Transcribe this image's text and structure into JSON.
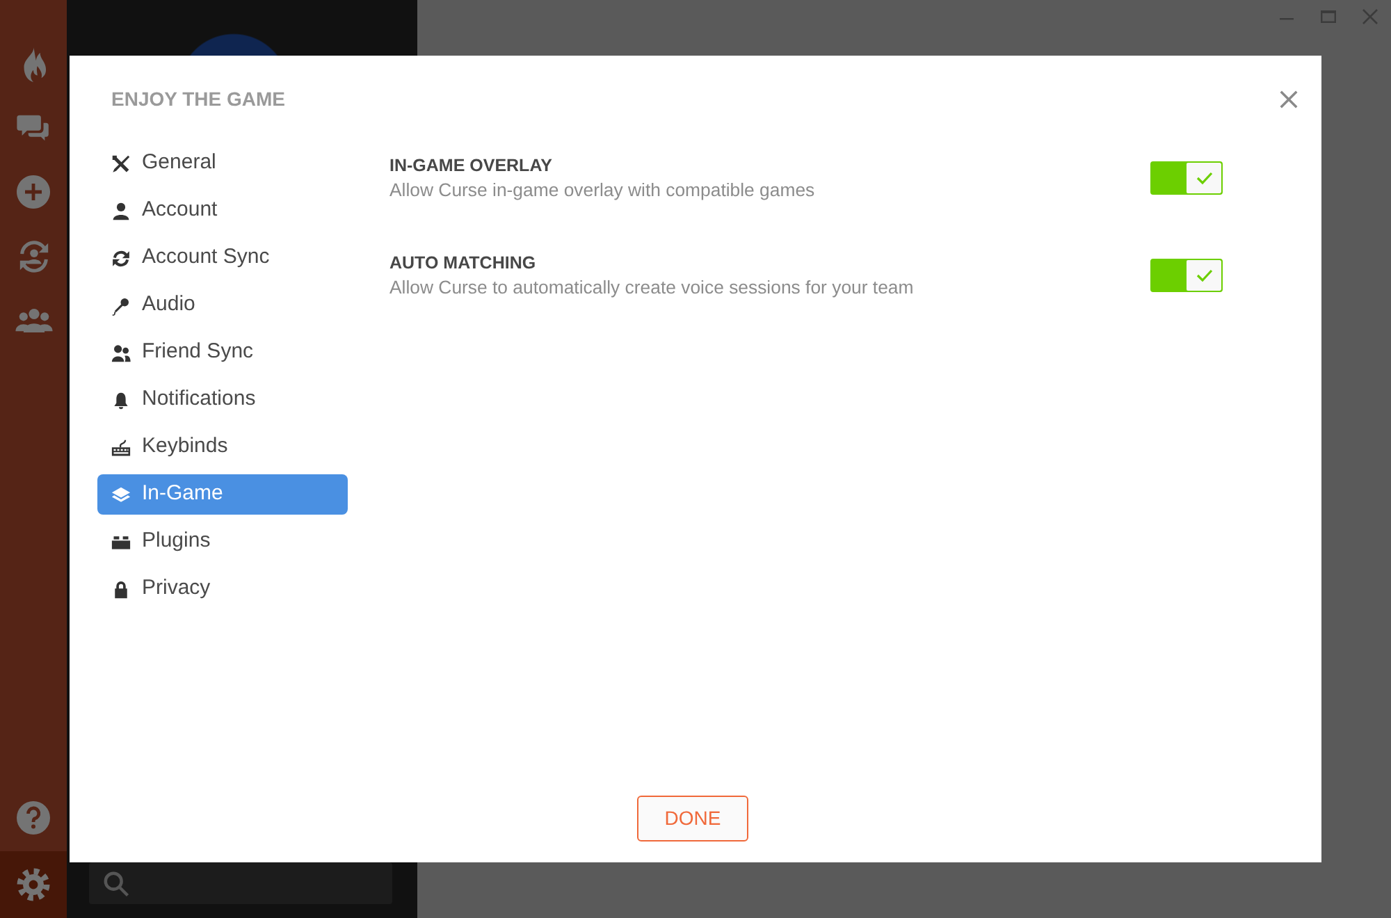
{
  "rail_top": [
    {
      "kind": "home",
      "selected": false
    },
    {
      "kind": "chat",
      "selected": false
    },
    {
      "kind": "add",
      "selected": false
    },
    {
      "kind": "sync",
      "selected": false
    },
    {
      "kind": "groups",
      "selected": false
    }
  ],
  "rail_bottom": [
    {
      "kind": "help",
      "selected": false
    },
    {
      "kind": "settings",
      "selected": true
    }
  ],
  "dialog": {
    "title": "ENJOY THE GAME",
    "nav": [
      {
        "kind": "general",
        "label": "General",
        "selected": false
      },
      {
        "kind": "account",
        "label": "Account",
        "selected": false
      },
      {
        "kind": "account_sync",
        "label": "Account Sync",
        "selected": false
      },
      {
        "kind": "audio",
        "label": "Audio",
        "selected": false
      },
      {
        "kind": "friend_sync",
        "label": "Friend Sync",
        "selected": false
      },
      {
        "kind": "notifications",
        "label": "Notifications",
        "selected": false
      },
      {
        "kind": "keybinds",
        "label": "Keybinds",
        "selected": false
      },
      {
        "kind": "in_game",
        "label": "In-Game",
        "selected": true
      },
      {
        "kind": "plugins",
        "label": "Plugins",
        "selected": false
      },
      {
        "kind": "privacy",
        "label": "Privacy",
        "selected": false
      }
    ],
    "settings": [
      {
        "title": "IN-GAME OVERLAY",
        "description": "Allow Curse in-game overlay with compatible games",
        "on": true
      },
      {
        "title": "AUTO MATCHING",
        "description": "Allow Curse to automatically create voice sessions for your team",
        "on": true
      }
    ],
    "done_button": "DONE"
  }
}
